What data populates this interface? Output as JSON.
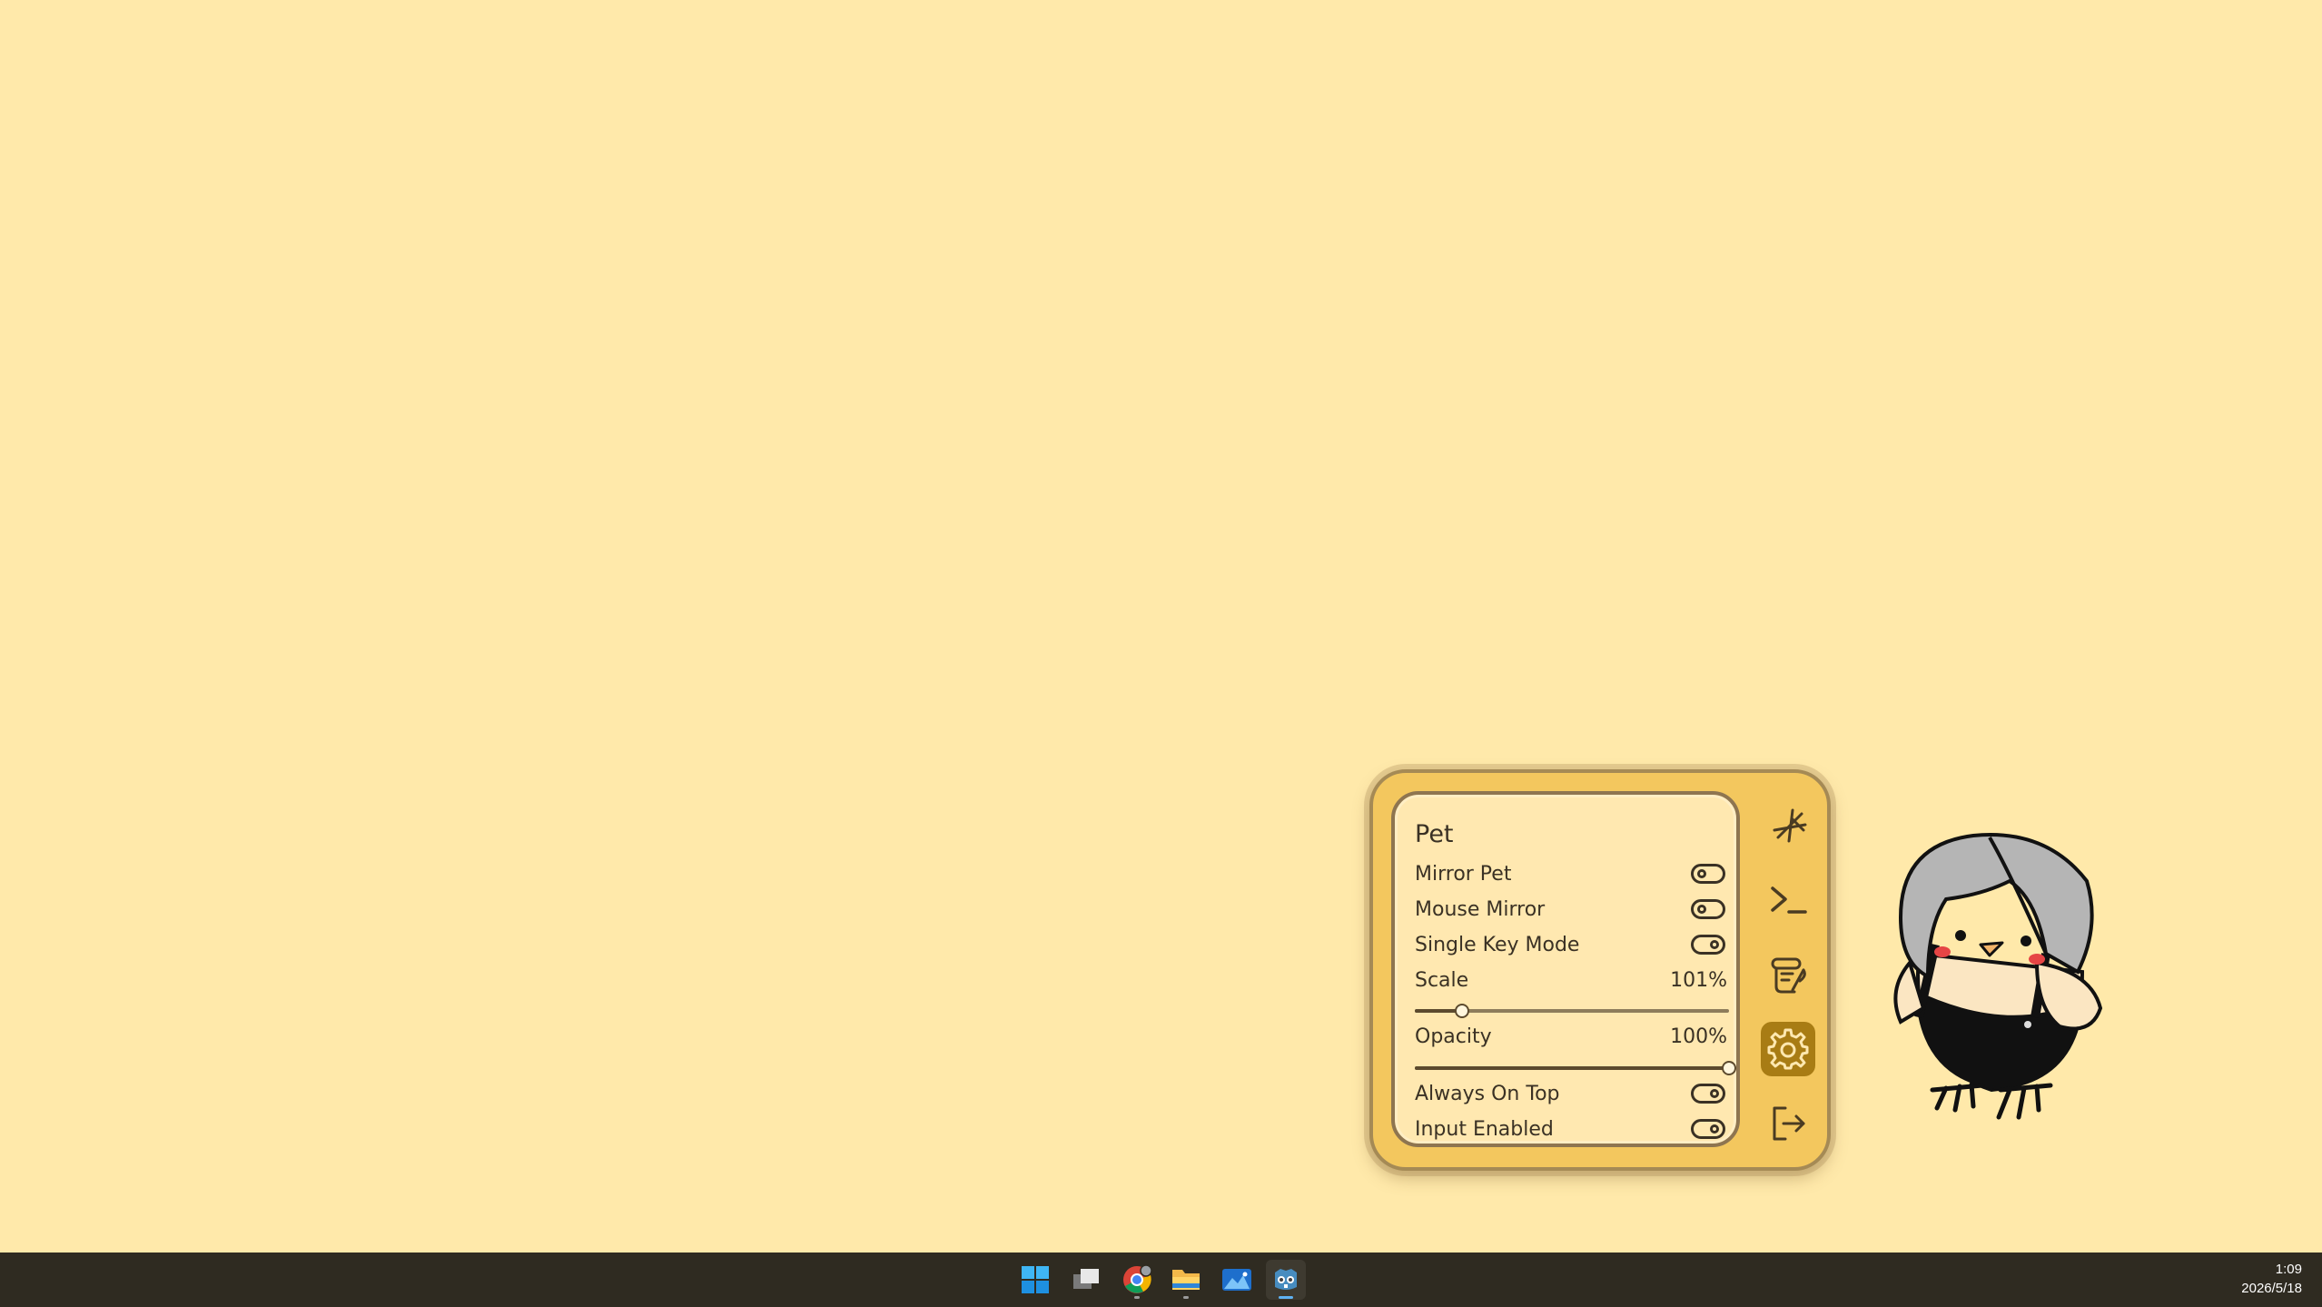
{
  "panel": {
    "title": "Pet",
    "toggles": [
      {
        "label": "Mirror Pet",
        "state": "off"
      },
      {
        "label": "Mouse Mirror",
        "state": "off"
      },
      {
        "label": "Single Key Mode",
        "state": "on"
      }
    ],
    "scale": {
      "label": "Scale",
      "value_text": "101%",
      "value_fraction": 0.15
    },
    "opacity": {
      "label": "Opacity",
      "value_text": "100%",
      "value_fraction": 1.0
    },
    "toggles_bottom": [
      {
        "label": "Always On Top",
        "state": "on"
      },
      {
        "label": "Input Enabled",
        "state": "on"
      }
    ]
  },
  "side_buttons": [
    {
      "icon": "sparkle-icon",
      "active": false
    },
    {
      "icon": "terminal-icon",
      "active": false
    },
    {
      "icon": "scroll-quill-icon",
      "active": false
    },
    {
      "icon": "gear-icon",
      "active": true
    },
    {
      "icon": "exit-icon",
      "active": false
    }
  ],
  "taskbar": {
    "apps": [
      {
        "icon": "windows-start-icon"
      },
      {
        "icon": "task-view-icon"
      },
      {
        "icon": "chrome-icon",
        "running": true
      },
      {
        "icon": "file-explorer-icon",
        "running": true
      },
      {
        "icon": "photos-icon"
      },
      {
        "icon": "godot-icon",
        "running": true,
        "active": true
      }
    ],
    "time": "1:09",
    "date": "2026/5/18"
  },
  "colors": {
    "desktop": "#FFE9AA",
    "panel_frame": "#F3C75E",
    "panel_inner": "#FFE8B0",
    "active_button": "#A87C14",
    "taskbar": "#2F2B21"
  }
}
